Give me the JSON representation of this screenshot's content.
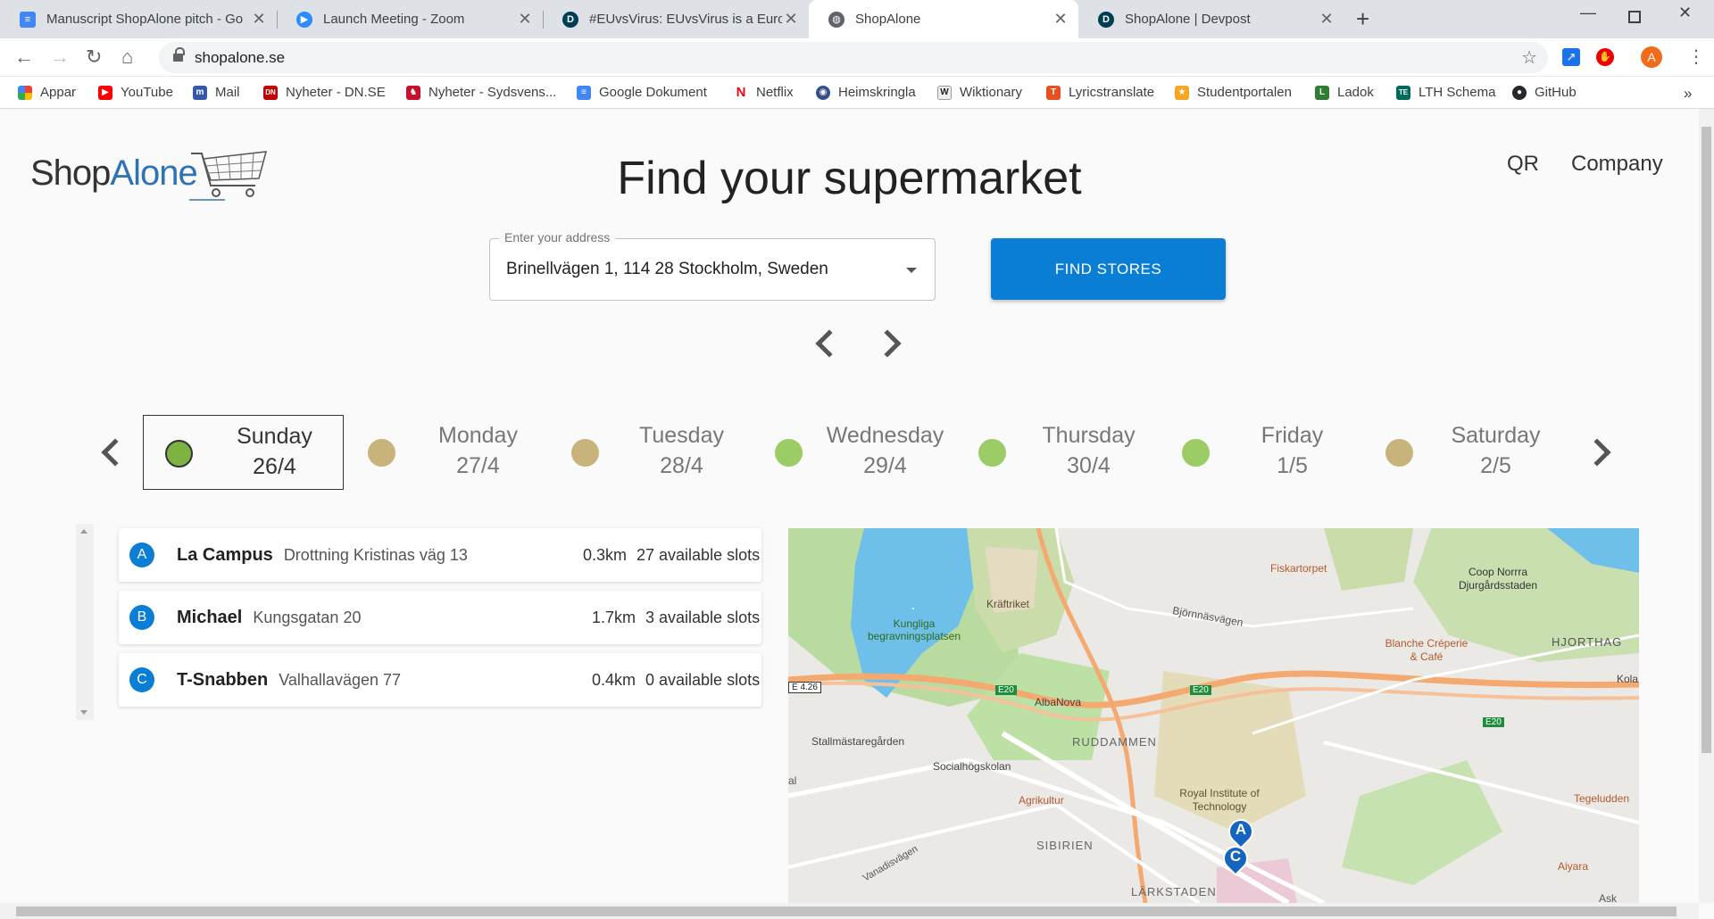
{
  "browser": {
    "tabs": [
      {
        "title": "Manuscript ShopAlone pitch - Go",
        "icon": "docs-icon",
        "color": "#4285f4"
      },
      {
        "title": "Launch Meeting - Zoom",
        "icon": "zoom-icon",
        "color": "#2d8cff"
      },
      {
        "title": "#EUvsVirus: EUvsVirus is a Europe",
        "icon": "devpost-icon",
        "color": "#003e54"
      },
      {
        "title": "ShopAlone",
        "icon": "globe-icon",
        "color": "#5f6368"
      },
      {
        "title": "ShopAlone | Devpost",
        "icon": "devpost-icon",
        "color": "#003e54"
      }
    ],
    "url": "shopalone.se",
    "profile_initial": "A",
    "bookmarks": [
      {
        "label": "Appar",
        "icon": "apps-grid-icon",
        "color": "#ea4335"
      },
      {
        "label": "YouTube",
        "icon": "youtube-icon",
        "color": "#ff0000"
      },
      {
        "label": "Mail",
        "icon": "mail-icon",
        "color": "#3558a8"
      },
      {
        "label": "Nyheter - DN.SE",
        "icon": "dn-icon",
        "color": "#c00000"
      },
      {
        "label": "Nyheter - Sydsvens...",
        "icon": "sydsvenskan-icon",
        "color": "#c8102e"
      },
      {
        "label": "Google Dokument",
        "icon": "docs-icon",
        "color": "#4285f4"
      },
      {
        "label": "Netflix",
        "icon": "netflix-icon",
        "color": "#e50914"
      },
      {
        "label": "Heimskringla",
        "icon": "heimskringla-icon",
        "color": "#34508a"
      },
      {
        "label": "Wiktionary",
        "icon": "wiktionary-icon",
        "color": "#444444"
      },
      {
        "label": "Lyricstranslate",
        "icon": "lyricstranslate-icon",
        "color": "#e8501f"
      },
      {
        "label": "Studentportalen",
        "icon": "studentportalen-icon",
        "color": "#f5a623"
      },
      {
        "label": "Ladok",
        "icon": "ladok-icon",
        "color": "#2e7d32"
      },
      {
        "label": "LTH Schema",
        "icon": "lth-icon",
        "color": "#00695c"
      },
      {
        "label": "GitHub",
        "icon": "github-icon",
        "color": "#24292e"
      }
    ]
  },
  "header": {
    "logo_shop": "Shop",
    "logo_alone": "Alone",
    "title": "Find your supermarket",
    "nav": [
      "QR",
      "Company"
    ]
  },
  "search": {
    "label": "Enter your address",
    "value": "Brinellvägen 1, 114 28 Stockholm, Sweden",
    "button": "FIND STORES"
  },
  "days": [
    {
      "name": "Sunday",
      "date": "26/4",
      "color": "#7cb342",
      "selected": true
    },
    {
      "name": "Monday",
      "date": "27/4",
      "color": "#c8b47a"
    },
    {
      "name": "Tuesday",
      "date": "28/4",
      "color": "#c8b47a"
    },
    {
      "name": "Wednesday",
      "date": "29/4",
      "color": "#9ccc65"
    },
    {
      "name": "Thursday",
      "date": "30/4",
      "color": "#9ccc65"
    },
    {
      "name": "Friday",
      "date": "1/5",
      "color": "#9ccc65"
    },
    {
      "name": "Saturday",
      "date": "2/5",
      "color": "#c8b47a"
    }
  ],
  "stores": [
    {
      "badge": "A",
      "name": "La Campus",
      "address": "Drottning Kristinas väg 13",
      "distance": "0.3km",
      "slots": "27 available slots"
    },
    {
      "badge": "B",
      "name": "Michael",
      "address": "Kungsgatan 20",
      "distance": "1.7km",
      "slots": "3 available slots"
    },
    {
      "badge": "C",
      "name": "T-Snabben",
      "address": "Valhallavägen 77",
      "distance": "0.4km",
      "slots": "0 available slots"
    }
  ],
  "map": {
    "labels": [
      "Kungliga begravningsplatsen",
      "Kräftriket",
      "Björnnäsvägen",
      "Fiskartorpet",
      "Coop Norrra Djurgårdsstaden",
      "Blanche Créperie & Café",
      "HJORTHAG",
      "Kola",
      "AlbaNova",
      "Stallmästaregården",
      "Socialhögskolan",
      "RUDDAMMEN",
      "Royal Institute of Technology",
      "Agrikultur",
      "SIBIRIEN",
      "Vanadisvägen",
      "LÄRKSTADEN",
      "Tegeludden",
      "Aiyara",
      "E 4.26",
      "E20",
      "al",
      "Ask"
    ],
    "markers": [
      "A",
      "C"
    ]
  }
}
